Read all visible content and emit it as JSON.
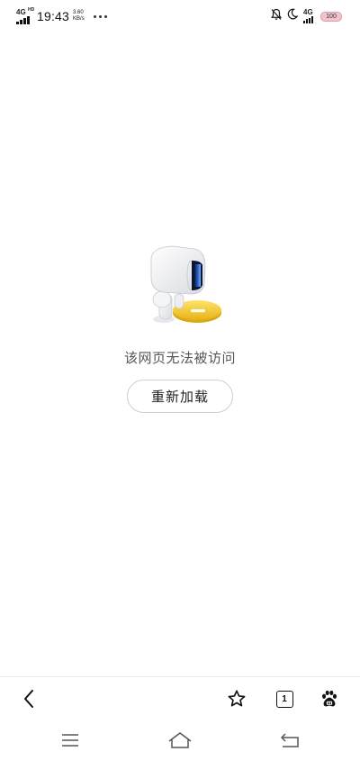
{
  "status_bar": {
    "network_type": "4G",
    "network_hd": "HD",
    "time": "19:43",
    "net_speed_value": "3.60",
    "net_speed_unit": "KB/s",
    "network_type_right": "4G",
    "battery": "100",
    "icons": [
      "signal-icon",
      "more-dots-icon",
      "mute-notification-icon",
      "do-not-disturb-moon-icon",
      "battery-icon"
    ]
  },
  "error_page": {
    "illustration": "robot-illustration",
    "message": "该网页无法被访问",
    "reload_label": "重新加载"
  },
  "toolbar": {
    "tab_count": "1",
    "icons": [
      "back-icon",
      "bookmark-star-icon",
      "tabs-icon",
      "baidu-paw-icon"
    ]
  },
  "nav_bar": {
    "icons": [
      "menu-icon",
      "home-icon",
      "return-icon"
    ]
  },
  "colors": {
    "accent_yellow": "#f2c62c",
    "robot_screen": "#2f6fe0",
    "battery_fill": "#f2c2cd"
  }
}
